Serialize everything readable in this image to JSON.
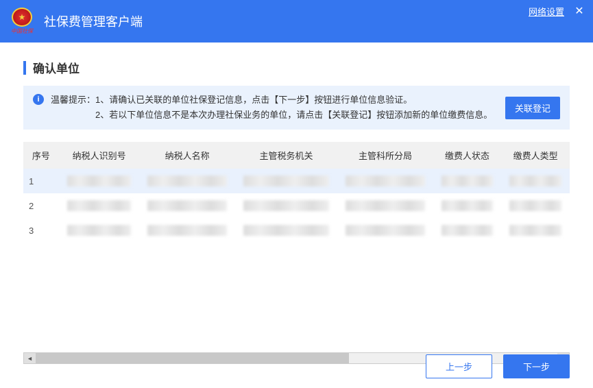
{
  "titlebar": {
    "title": "社保费管理客户端",
    "network_link": "网络设置",
    "logo_sub": "中国社保"
  },
  "page": {
    "title": "确认单位"
  },
  "info": {
    "prefix": "温馨提示：",
    "line1": "1、请确认已关联的单位社保登记信息，点击【下一步】按钮进行单位信息验证。",
    "line2": "2、若以下单位信息不是本次办理社保业务的单位，请点击【关联登记】按钮添加新的单位缴费信息。",
    "link_btn": "关联登记"
  },
  "table": {
    "headers": [
      "序号",
      "纳税人识别号",
      "纳税人名称",
      "主管税务机关",
      "主管科所分局",
      "缴费人状态",
      "缴费人类型"
    ],
    "rows": [
      {
        "seq": "1"
      },
      {
        "seq": "2"
      },
      {
        "seq": "3"
      }
    ]
  },
  "footer": {
    "prev": "上一步",
    "next": "下一步"
  }
}
